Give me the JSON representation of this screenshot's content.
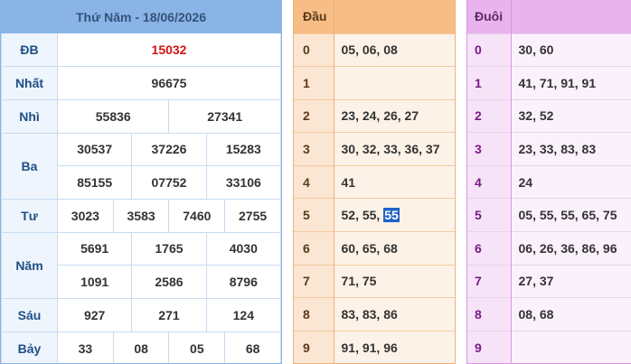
{
  "results": {
    "title": "Thứ Năm - 18/06/2026",
    "rows": [
      {
        "label": "ĐB",
        "values": [
          "15032"
        ]
      },
      {
        "label": "Nhất",
        "values": [
          "96675"
        ]
      },
      {
        "label": "Nhì",
        "values": [
          "55836",
          "27341"
        ]
      },
      {
        "label": "Ba",
        "values": [
          "30537",
          "37226",
          "15283",
          "85155",
          "07752",
          "33106"
        ]
      },
      {
        "label": "Tư",
        "values": [
          "3023",
          "3583",
          "7460",
          "2755"
        ]
      },
      {
        "label": "Năm",
        "values": [
          "5691",
          "1765",
          "4030",
          "1091",
          "2586",
          "8796"
        ]
      },
      {
        "label": "Sáu",
        "values": [
          "927",
          "271",
          "124"
        ]
      },
      {
        "label": "Bảy",
        "values": [
          "33",
          "08",
          "05",
          "68"
        ]
      }
    ]
  },
  "dau": {
    "header_key": "Đầu",
    "header_val": "",
    "rows": [
      {
        "k": "0",
        "v": "05, 06, 08"
      },
      {
        "k": "1",
        "v": ""
      },
      {
        "k": "2",
        "v": "23, 24, 26, 27"
      },
      {
        "k": "3",
        "v": "30, 32, 33, 36, 37"
      },
      {
        "k": "4",
        "v": "41"
      },
      {
        "k": "5",
        "v_prefix": "52, 55, ",
        "v_highlight": "55"
      },
      {
        "k": "6",
        "v": "60, 65, 68"
      },
      {
        "k": "7",
        "v": "71, 75"
      },
      {
        "k": "8",
        "v": "83, 83, 86"
      },
      {
        "k": "9",
        "v": "91, 91, 96"
      }
    ]
  },
  "duoi": {
    "header_key": "Đuôi",
    "header_val": "",
    "rows": [
      {
        "k": "0",
        "v": "30, 60"
      },
      {
        "k": "1",
        "v": "41, 71, 91, 91"
      },
      {
        "k": "2",
        "v": "32, 52"
      },
      {
        "k": "3",
        "v": "23, 33, 83, 83"
      },
      {
        "k": "4",
        "v": "24"
      },
      {
        "k": "5",
        "v": "05, 55, 55, 65, 75"
      },
      {
        "k": "6",
        "v": "06, 26, 36, 86, 96"
      },
      {
        "k": "7",
        "v": "27, 37"
      },
      {
        "k": "8",
        "v": "08, 68"
      },
      {
        "k": "9",
        "v": ""
      }
    ]
  },
  "colors": {
    "results_header": "#8ab4e6",
    "special_prize": "#d21414",
    "dau_header": "#f7bd86",
    "duoi_header": "#e9b3ee",
    "highlight": "#1f63c6"
  }
}
